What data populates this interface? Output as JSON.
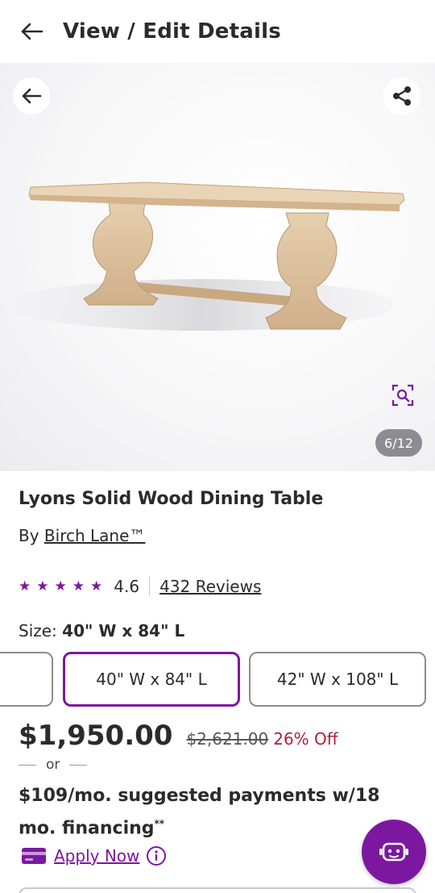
{
  "header": {
    "title": "View / Edit Details",
    "back_icon": "arrow-left-icon"
  },
  "gallery": {
    "counter": "6/12",
    "share_icon": "share-icon",
    "zoom_icon": "zoom-search-icon",
    "back_icon": "arrow-left-icon"
  },
  "product": {
    "name": "Lyons Solid Wood Dining Table",
    "brand_prefix": "By",
    "brand": "Birch Lane™",
    "rating": "4.6",
    "stars": 5,
    "reviews": "432 Reviews"
  },
  "size": {
    "label": "Size:",
    "selected": "40\" W x 84\" L",
    "options": [
      "",
      "40\" W x 84\" L",
      "42\" W x 108\" L"
    ]
  },
  "pricing": {
    "price": "$1,950.00",
    "was": "$2,621.00",
    "discount": "26% Off",
    "or": "or",
    "financing": "$109/mo. suggested payments w/18 mo. financing",
    "financing_mark": "**",
    "apply_label": "Apply Now"
  },
  "colors": {
    "accent": "#7b189f",
    "discount": "#b0203a",
    "text": "#2b2b2b"
  },
  "assistant": {
    "icon": "robot-assistant-icon"
  }
}
